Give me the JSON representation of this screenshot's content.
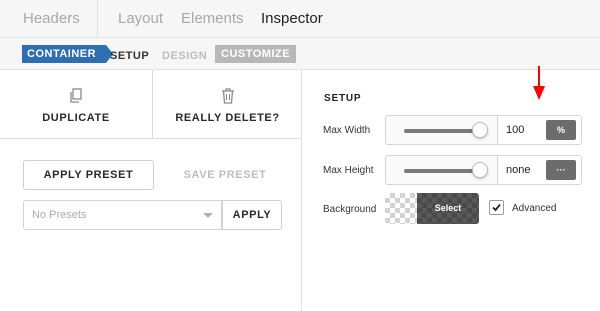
{
  "top_tabs": [
    {
      "label": "Headers",
      "active": false
    },
    {
      "label": "Layout",
      "active": false
    },
    {
      "label": "Elements",
      "active": false
    },
    {
      "label": "Inspector",
      "active": true
    }
  ],
  "breadcrumb": {
    "container": "CONTAINER",
    "setup": "SETUP",
    "design": "DESIGN",
    "customize": "CUSTOMIZE"
  },
  "actions": {
    "duplicate": {
      "label": "DUPLICATE",
      "icon": "copy-icon"
    },
    "delete": {
      "label": "REALLY DELETE?",
      "icon": "trash-icon"
    }
  },
  "presets": {
    "apply_preset_label": "APPLY PRESET",
    "save_preset_label": "SAVE PRESET",
    "select_value": "No Presets",
    "apply_label": "APPLY"
  },
  "setup": {
    "title": "SETUP",
    "max_width": {
      "label": "Max Width",
      "value": "100",
      "unit": "%"
    },
    "max_height": {
      "label": "Max Height",
      "value": "none",
      "unit": "···"
    },
    "background": {
      "label": "Background",
      "button": "Select"
    },
    "advanced": {
      "label": "Advanced",
      "checked": true
    }
  },
  "colors": {
    "accent": "#2e6fb1",
    "annotation_arrow": "#ff0000"
  }
}
